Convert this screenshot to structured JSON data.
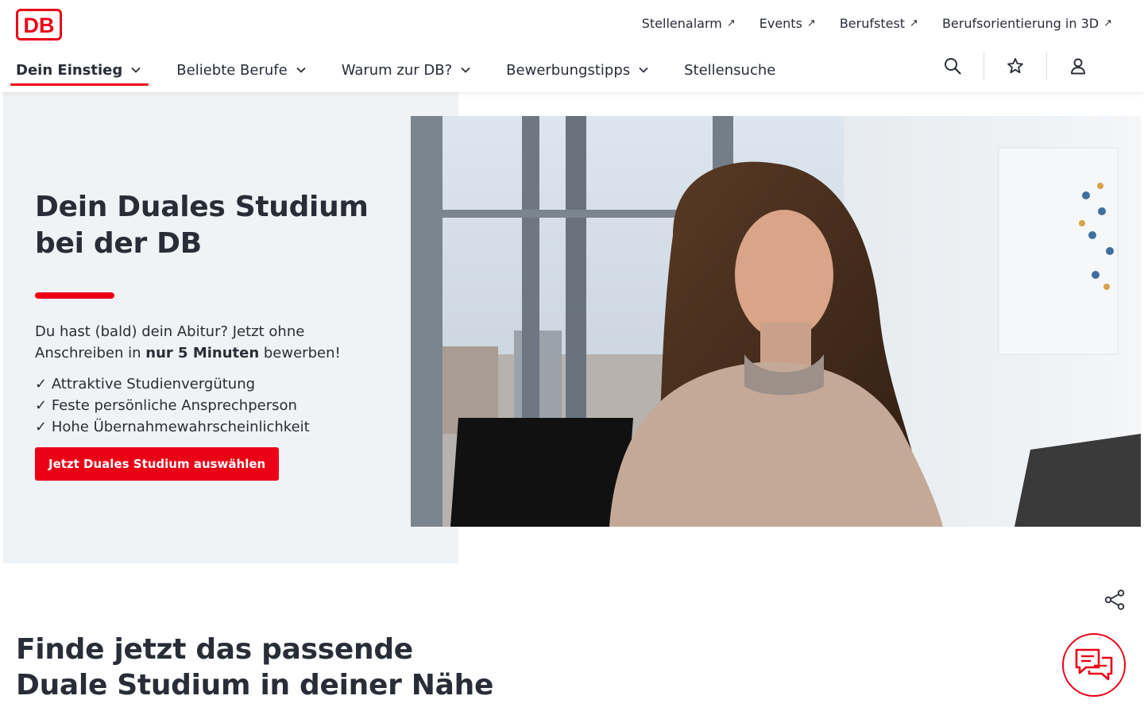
{
  "brand": {
    "logo_text": "DB",
    "accent_color": "#ec0016"
  },
  "meta_nav": [
    {
      "label": "Stellenalarm"
    },
    {
      "label": "Events"
    },
    {
      "label": "Berufstest"
    },
    {
      "label": "Berufsorientierung in 3D"
    }
  ],
  "main_nav": [
    {
      "label": "Dein Einstieg",
      "active": true,
      "has_dropdown": true
    },
    {
      "label": "Beliebte Berufe",
      "has_dropdown": true
    },
    {
      "label": "Warum zur DB?",
      "has_dropdown": true
    },
    {
      "label": "Bewerbungstipps",
      "has_dropdown": true
    },
    {
      "label": "Stellensuche",
      "has_dropdown": false
    }
  ],
  "utility_icons": [
    "search-icon",
    "star-icon",
    "user-icon"
  ],
  "hero": {
    "title_line1": "Dein Duales Studium",
    "title_line2": "bei der DB",
    "lead_part1": "Du hast (bald) dein Abitur? Jetzt ohne Anschreiben in ",
    "lead_bold": "nur 5 Minuten",
    "lead_part2": " bewerben!",
    "benefits": [
      "Attraktive Studienvergütung",
      "Feste persönliche Ansprechperson",
      "Hohe Übernahmewahrscheinlichkeit"
    ],
    "cta_label": "Jetzt Duales Studium auswählen"
  },
  "section": {
    "title_line1": "Finde jetzt das passende",
    "title_line2": "Duale Studium in deiner Nähe"
  },
  "floating": {
    "share_icon": "share-icon",
    "chat_icon": "chat-icon"
  }
}
